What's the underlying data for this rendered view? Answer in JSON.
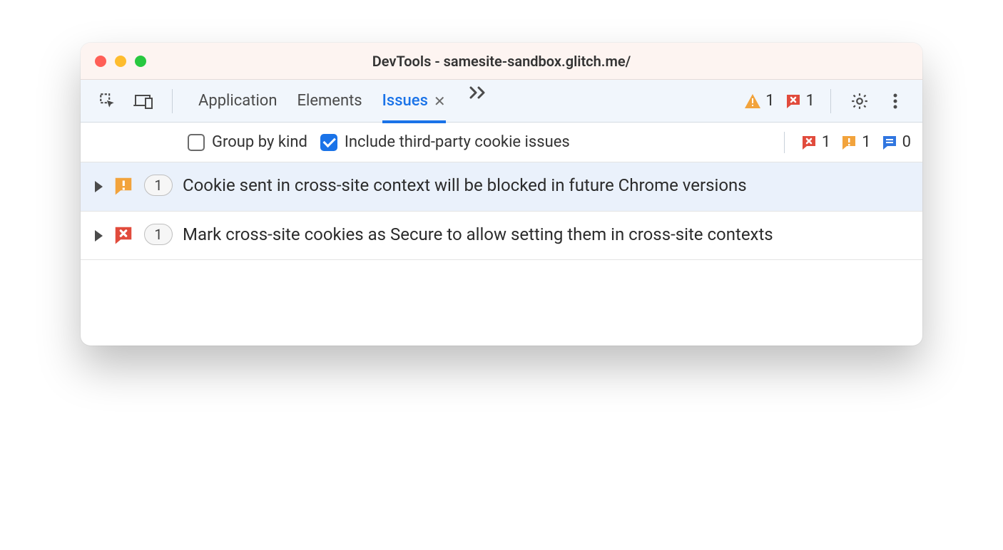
{
  "window": {
    "title": "DevTools - samesite-sandbox.glitch.me/"
  },
  "tabs": {
    "application": "Application",
    "elements": "Elements",
    "issues": "Issues"
  },
  "header_counts": {
    "warnings": "1",
    "errors": "1"
  },
  "filter": {
    "group_by_kind": "Group by kind",
    "include_third_party": "Include third-party cookie issues"
  },
  "filter_counts": {
    "errors": "1",
    "warnings": "1",
    "info": "0"
  },
  "issues": [
    {
      "count": "1",
      "title": "Cookie sent in cross-site context will be blocked in future Chrome versions"
    },
    {
      "count": "1",
      "title": "Mark cross-site cookies as Secure to allow setting them in cross-site contexts"
    }
  ]
}
